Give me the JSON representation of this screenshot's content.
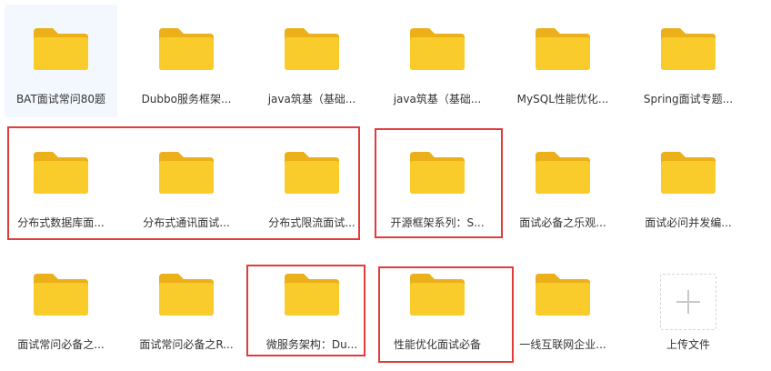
{
  "folders": [
    {
      "name": "BAT面试常问80题"
    },
    {
      "name": "Dubbo服务框架..."
    },
    {
      "name": "java筑基（基础..."
    },
    {
      "name": "java筑基（基础..."
    },
    {
      "name": "MySQL性能优化..."
    },
    {
      "name": "Spring面试专题..."
    },
    {
      "name": "分布式数据库面..."
    },
    {
      "name": "分布式通讯面试..."
    },
    {
      "name": "分布式限流面试..."
    },
    {
      "name": "开源框架系列：S..."
    },
    {
      "name": "面试必备之乐观..."
    },
    {
      "name": "面试必问并发编..."
    },
    {
      "name": "面试常问必备之..."
    },
    {
      "name": "面试常问必备之R..."
    },
    {
      "name": "微服务架构：Du..."
    },
    {
      "name": "性能优化面试必备"
    },
    {
      "name": "一线互联网企业..."
    }
  ],
  "upload": {
    "label": "上传文件"
  },
  "colors": {
    "folder_body": "#f9cc2b",
    "folder_tab": "#ebb01a",
    "highlight_border": "#e23b3b",
    "selected_bg": "#f3f8fe"
  }
}
